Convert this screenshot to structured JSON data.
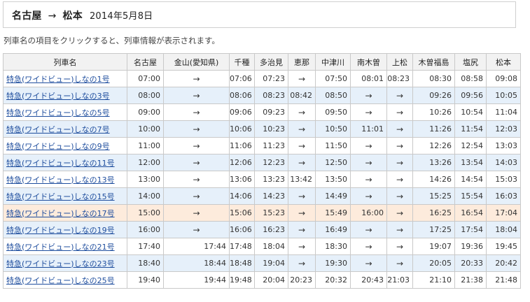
{
  "header": {
    "origin": "名古屋",
    "arrow": "→",
    "destination": "松本",
    "date": "2014年5月8日"
  },
  "instruction": "列車名の項目をクリックすると、列車情報が表示されます。",
  "table": {
    "columns": [
      "列車名",
      "名古屋",
      "金山(愛知県)",
      "千種",
      "多治見",
      "恵那",
      "中津川",
      "南木曽",
      "上松",
      "木曽福島",
      "塩尻",
      "松本"
    ],
    "rows": [
      {
        "name": "特急(ワイドビュー)しなの1号",
        "times": [
          "07:00",
          "→",
          "07:06",
          "07:23",
          "→",
          "07:50",
          "08:01",
          "08:23",
          "08:30",
          "08:58",
          "09:08"
        ]
      },
      {
        "name": "特急(ワイドビュー)しなの3号",
        "times": [
          "08:00",
          "→",
          "08:06",
          "08:23",
          "08:42",
          "08:50",
          "→",
          "→",
          "09:26",
          "09:56",
          "10:05"
        ]
      },
      {
        "name": "特急(ワイドビュー)しなの5号",
        "times": [
          "09:00",
          "→",
          "09:06",
          "09:23",
          "→",
          "09:50",
          "→",
          "→",
          "10:26",
          "10:54",
          "11:04"
        ]
      },
      {
        "name": "特急(ワイドビュー)しなの7号",
        "times": [
          "10:00",
          "→",
          "10:06",
          "10:23",
          "→",
          "10:50",
          "11:01",
          "→",
          "11:26",
          "11:54",
          "12:03"
        ]
      },
      {
        "name": "特急(ワイドビュー)しなの9号",
        "times": [
          "11:00",
          "→",
          "11:06",
          "11:23",
          "→",
          "11:50",
          "→",
          "→",
          "12:26",
          "12:54",
          "13:03"
        ]
      },
      {
        "name": "特急(ワイドビュー)しなの11号",
        "times": [
          "12:00",
          "→",
          "12:06",
          "12:23",
          "→",
          "12:50",
          "→",
          "→",
          "13:26",
          "13:54",
          "14:03"
        ]
      },
      {
        "name": "特急(ワイドビュー)しなの13号",
        "times": [
          "13:00",
          "→",
          "13:06",
          "13:23",
          "13:42",
          "13:50",
          "→",
          "→",
          "14:26",
          "14:54",
          "15:03"
        ]
      },
      {
        "name": "特急(ワイドビュー)しなの15号",
        "times": [
          "14:00",
          "→",
          "14:06",
          "14:23",
          "→",
          "14:49",
          "→",
          "→",
          "15:25",
          "15:54",
          "16:03"
        ]
      },
      {
        "name": "特急(ワイドビュー)しなの17号",
        "times": [
          "15:00",
          "→",
          "15:06",
          "15:23",
          "→",
          "15:49",
          "16:00",
          "→",
          "16:25",
          "16:54",
          "17:04"
        ]
      },
      {
        "name": "特急(ワイドビュー)しなの19号",
        "times": [
          "16:00",
          "→",
          "16:06",
          "16:23",
          "→",
          "16:49",
          "→",
          "→",
          "17:25",
          "17:54",
          "18:04"
        ]
      },
      {
        "name": "特急(ワイドビュー)しなの21号",
        "times": [
          "17:40",
          "17:44",
          "17:48",
          "18:04",
          "→",
          "18:30",
          "→",
          "→",
          "19:07",
          "19:36",
          "19:45"
        ]
      },
      {
        "name": "特急(ワイドビュー)しなの23号",
        "times": [
          "18:40",
          "18:44",
          "18:48",
          "19:04",
          "→",
          "19:30",
          "→",
          "→",
          "20:05",
          "20:33",
          "20:42"
        ]
      },
      {
        "name": "特急(ワイドビュー)しなの25号",
        "times": [
          "19:40",
          "19:44",
          "19:48",
          "20:04",
          "20:23",
          "20:32",
          "20:43",
          "21:03",
          "21:10",
          "21:38",
          "21:48"
        ]
      }
    ],
    "highlighted_row_index": 8
  },
  "colors": {
    "link": "#1f4e9e",
    "row_alt": "#e6f0fa",
    "row_highlight": "#fdebdc",
    "header_bg": "#f2f2f2",
    "border": "#c9c9c9"
  }
}
